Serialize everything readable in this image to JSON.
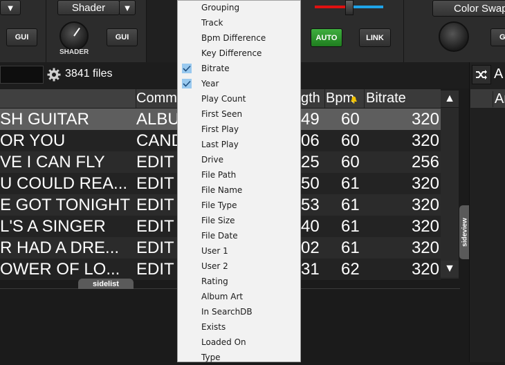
{
  "deck": {
    "left_dropdown_arrow": "▼",
    "shader_dropdown": "Shader",
    "shader_dropdown_arrow": "▼",
    "gui_left": "GUI",
    "gui_mid": "GUI",
    "shader_label": "SHADER",
    "auto_button": "AUTO",
    "link_button": "LINK",
    "color_swap_dropdown": "Color Swap",
    "gui_right": "G"
  },
  "browser": {
    "file_count": "3841 files"
  },
  "table": {
    "headers": [
      "Comm",
      "gth",
      "Bpm",
      "Bitrate"
    ],
    "rows": [
      {
        "title": "SH GUITAR",
        "comment": "ALBU",
        "length": "49",
        "bpm": "60",
        "bitrate": "320"
      },
      {
        "title": "OR YOU",
        "comment": "CAND",
        "length": "06",
        "bpm": "60",
        "bitrate": "320"
      },
      {
        "title": "VE I CAN FLY",
        "comment": "EDIT",
        "length": "25",
        "bpm": "60",
        "bitrate": "256"
      },
      {
        "title": "U COULD REA...",
        "comment": "EDIT",
        "length": "50",
        "bpm": "61",
        "bitrate": "320"
      },
      {
        "title": "E GOT TONIGHT",
        "comment": "EDIT",
        "length": "53",
        "bpm": "61",
        "bitrate": "320"
      },
      {
        "title": "L'S A SINGER",
        "comment": "EDIT",
        "length": "40",
        "bpm": "61",
        "bitrate": "320"
      },
      {
        "title": "R HAD A DRE...",
        "comment": "EDIT",
        "length": "02",
        "bpm": "61",
        "bitrate": "320"
      },
      {
        "title": "OWER OF LO...",
        "comment": "EDIT",
        "length": "31",
        "bpm": "62",
        "bitrate": "320"
      }
    ],
    "scroll_up": "▲",
    "scroll_down": "▼"
  },
  "tabs": {
    "sidelist": "sidelist",
    "sideview": "sideview"
  },
  "right_panel": {
    "header_letter": "A",
    "column_letter": "Ar"
  },
  "context_menu": {
    "items": [
      {
        "label": "Grouping",
        "checked": false
      },
      {
        "label": "Track",
        "checked": false
      },
      {
        "label": "Bpm Difference",
        "checked": false
      },
      {
        "label": "Key Difference",
        "checked": false
      },
      {
        "label": "Bitrate",
        "checked": true
      },
      {
        "label": "Year",
        "checked": true
      },
      {
        "label": "Play Count",
        "checked": false
      },
      {
        "label": "First Seen",
        "checked": false
      },
      {
        "label": "First Play",
        "checked": false
      },
      {
        "label": "Last Play",
        "checked": false
      },
      {
        "label": "Drive",
        "checked": false
      },
      {
        "label": "File Path",
        "checked": false
      },
      {
        "label": "File Name",
        "checked": false
      },
      {
        "label": "File Type",
        "checked": false
      },
      {
        "label": "File Size",
        "checked": false
      },
      {
        "label": "File Date",
        "checked": false
      },
      {
        "label": "User 1",
        "checked": false
      },
      {
        "label": "User 2",
        "checked": false
      },
      {
        "label": "Rating",
        "checked": false
      },
      {
        "label": "Album Art",
        "checked": false
      },
      {
        "label": "In SearchDB",
        "checked": false
      },
      {
        "label": "Exists",
        "checked": false
      },
      {
        "label": "Loaded On",
        "checked": false
      },
      {
        "label": "Type",
        "checked": false
      }
    ]
  },
  "colors": {
    "check_highlight": "#99c9ef",
    "selected_row": "#5e5e5e",
    "auto_green": "#2e9a2e",
    "crossfader_red": "#e01010",
    "crossfader_blue": "#1fa3e8"
  }
}
